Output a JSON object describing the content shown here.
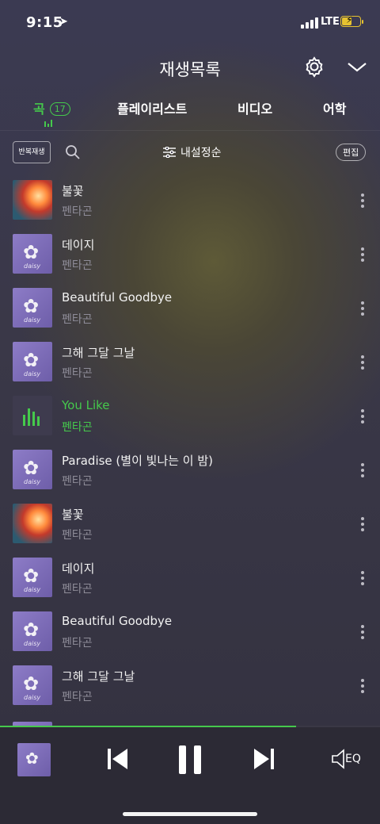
{
  "status": {
    "time": "9:15",
    "network": "LTE"
  },
  "header": {
    "title": "재생목록"
  },
  "tabs": [
    {
      "label": "곡",
      "count": "17"
    },
    {
      "label": "플레이리스트"
    },
    {
      "label": "비디오"
    },
    {
      "label": "어학"
    }
  ],
  "toolbar": {
    "repeat_label": "반복재생",
    "sort_label": "내설정순",
    "edit_label": "편집"
  },
  "songs": [
    {
      "title": "불꽃",
      "artist": "펜타곤"
    },
    {
      "title": "데이지",
      "artist": "펜타곤"
    },
    {
      "title": "Beautiful Goodbye",
      "artist": "펜타곤"
    },
    {
      "title": "그해 그달 그날",
      "artist": "펜타곤"
    },
    {
      "title": "You Like",
      "artist": "펜타곤"
    },
    {
      "title": "Paradise (별이 빛나는 이 밤)",
      "artist": "펜타곤"
    },
    {
      "title": "불꽃",
      "artist": "펜타곤"
    },
    {
      "title": "데이지",
      "artist": "펜타곤"
    },
    {
      "title": "Beautiful Goodbye",
      "artist": "펜타곤"
    },
    {
      "title": "그해 그달 그날",
      "artist": "펜타곤"
    }
  ],
  "album_signature": "daisy",
  "player": {
    "eq_label": "EQ",
    "progress": 0.78
  },
  "colors": {
    "accent": "#45c94c",
    "background": "#3a3848"
  }
}
